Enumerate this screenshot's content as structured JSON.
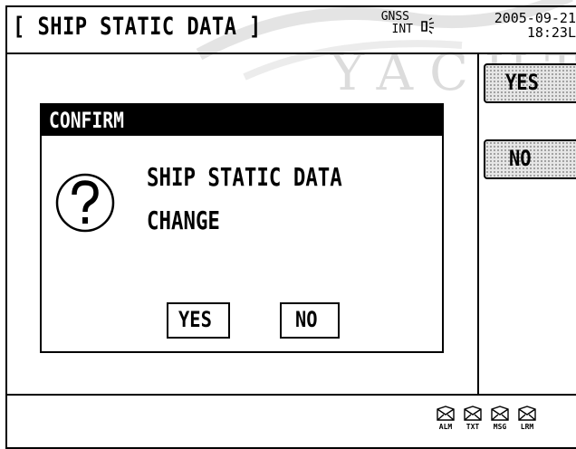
{
  "header": {
    "title": "[ SHIP STATIC DATA ]",
    "gnss_line1": "GNSS",
    "gnss_line2": "INT",
    "date": "2005-09-21",
    "time": "18:23L"
  },
  "watermark": {
    "text": "YACHT"
  },
  "side_buttons": {
    "yes": "YES",
    "no": "NO"
  },
  "dialog": {
    "title": "CONFIRM",
    "icon": "question-icon",
    "message_line1": "SHIP STATIC DATA",
    "message_line2": "CHANGE",
    "yes_label": "YES",
    "no_label": "NO"
  },
  "status_bar": {
    "icons": [
      {
        "name": "alm-icon",
        "label": "ALM"
      },
      {
        "name": "txt-icon",
        "label": "TXT"
      },
      {
        "name": "msg-icon",
        "label": "MSG"
      },
      {
        "name": "lrm-icon",
        "label": "LRM"
      }
    ]
  },
  "colors": {
    "background": "#ffffff",
    "foreground": "#000000",
    "watermark": "#dcdcdc"
  }
}
